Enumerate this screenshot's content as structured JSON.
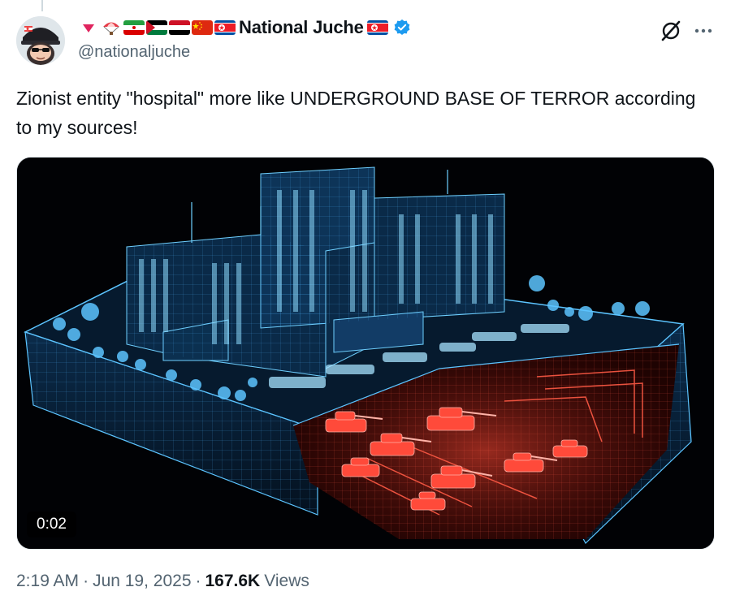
{
  "author": {
    "display_name": "National Juche",
    "handle": "@nationaljuche",
    "verified": true,
    "name_prefix_emojis": [
      "red-triangle",
      "parachute",
      "flag-iran",
      "flag-palestine",
      "flag-yemen",
      "flag-china",
      "flag-north-korea"
    ],
    "name_suffix_emojis": [
      "flag-north-korea"
    ]
  },
  "tweet": {
    "text": "Zionist entity \"hospital\" more like UNDERGROUND BASE OF TERROR according to my sources!"
  },
  "media": {
    "type": "video",
    "duration": "0:02"
  },
  "meta": {
    "time": "2:19 AM",
    "sep1": "·",
    "date": "Jun 19, 2025",
    "sep2": "·",
    "views_count": "167.6K",
    "views_label": "Views"
  },
  "icons": {
    "grok": "grok-icon",
    "more": "more-icon",
    "verified": "verified-badge-icon"
  },
  "colors": {
    "verified_blue": "#1d9bf0",
    "secondary_text": "#536471",
    "blueprint_blue": "#4fb6ff",
    "tunnel_red": "#ff3b2f"
  }
}
